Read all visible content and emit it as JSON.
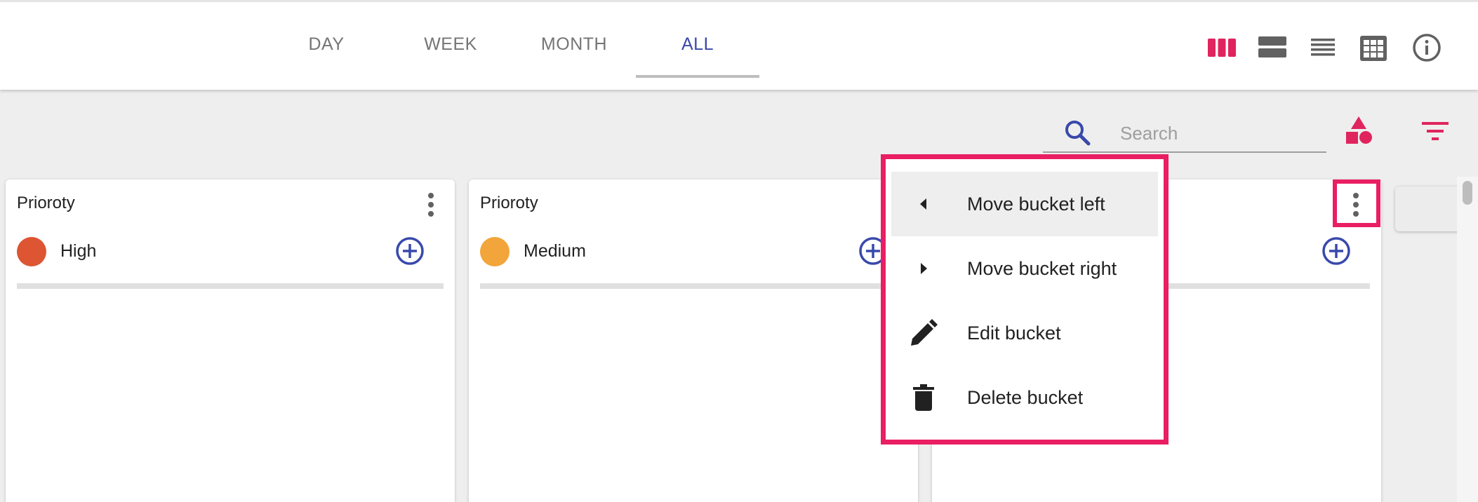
{
  "tabs": [
    {
      "label": "DAY",
      "active": false
    },
    {
      "label": "WEEK",
      "active": false
    },
    {
      "label": "MONTH",
      "active": false
    },
    {
      "label": "ALL",
      "active": true
    }
  ],
  "view_icons": [
    "columns-view-icon",
    "rows-view-icon",
    "list-view-icon",
    "grid-view-icon",
    "info-icon"
  ],
  "search": {
    "placeholder": "Search",
    "value": ""
  },
  "buckets": [
    {
      "title": "Prioroty",
      "label": "High",
      "color": "#dd5532"
    },
    {
      "title": "Prioroty",
      "label": "Medium",
      "color": "#f2a53b"
    },
    {
      "title": "",
      "label": "",
      "color": ""
    }
  ],
  "menu": {
    "items": [
      {
        "label": "Move bucket left",
        "icon": "arrow-left-icon"
      },
      {
        "label": "Move bucket right",
        "icon": "arrow-right-icon"
      },
      {
        "label": "Edit bucket",
        "icon": "pencil-icon"
      },
      {
        "label": "Delete bucket",
        "icon": "trash-icon"
      }
    ]
  },
  "colors": {
    "accent": "#3949ab",
    "highlight": "#e91e63",
    "icon_pink": "#e0245e"
  }
}
